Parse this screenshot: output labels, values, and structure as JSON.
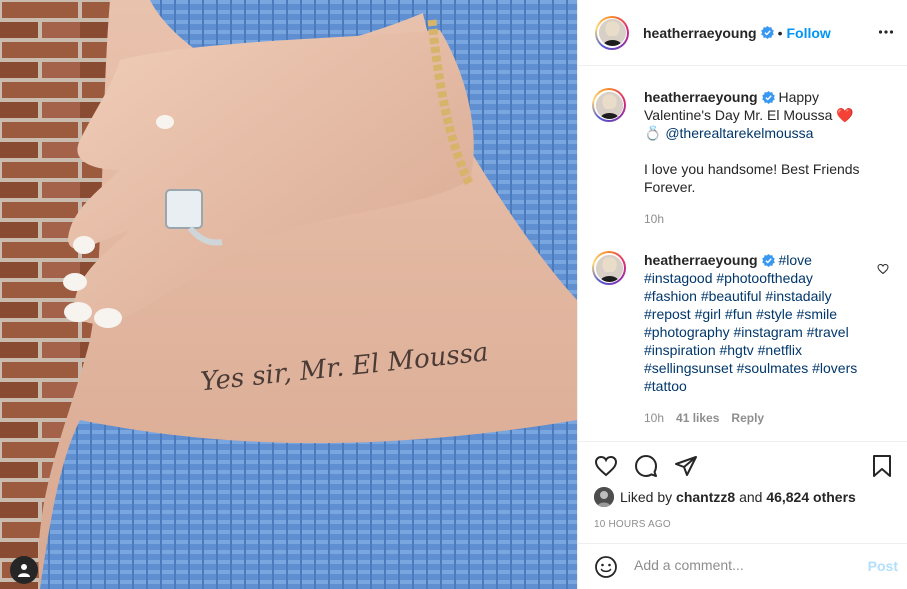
{
  "header": {
    "username": "heatherraeyoung",
    "separator": "•",
    "follow_label": "Follow"
  },
  "caption": {
    "username": "heatherraeyoung",
    "line1": "Happy Valentine's Day Mr. El Moussa",
    "emoji": "❤️💍",
    "mention": "@therealtarekelmoussa",
    "line2": "I love you handsome! Best Friends Forever.",
    "time": "10h"
  },
  "hashtag_comment": {
    "username": "heatherraeyoung",
    "hashtags": "#love #instagood #photooftheday #fashion #beautiful #instadaily #repost #girl #fun #style #smile #photography #instagram #travel #inspiration #hgtv #netflix #sellingsunset #soulmates #lovers #tattoo",
    "time": "10h",
    "likes": "41 likes",
    "reply_label": "Reply"
  },
  "likes": {
    "prefix": "Liked by",
    "user": "chantzz8",
    "and": "and",
    "others": "46,824 others"
  },
  "timestamp": "10 HOURS AGO",
  "add_comment": {
    "placeholder": "Add a comment...",
    "post_label": "Post"
  },
  "photo": {
    "tattoo_text": "Yes sir, Mr. El Moussa"
  },
  "icons": [
    "verified-badge-icon",
    "more-options-icon",
    "heart-icon",
    "comment-icon",
    "share-icon",
    "bookmark-icon",
    "emoji-icon",
    "user-tag-icon"
  ],
  "colors": {
    "link": "#0095f6",
    "hashtag": "#00376b",
    "muted": "#8e8e8e",
    "heart": "#ed4956"
  }
}
